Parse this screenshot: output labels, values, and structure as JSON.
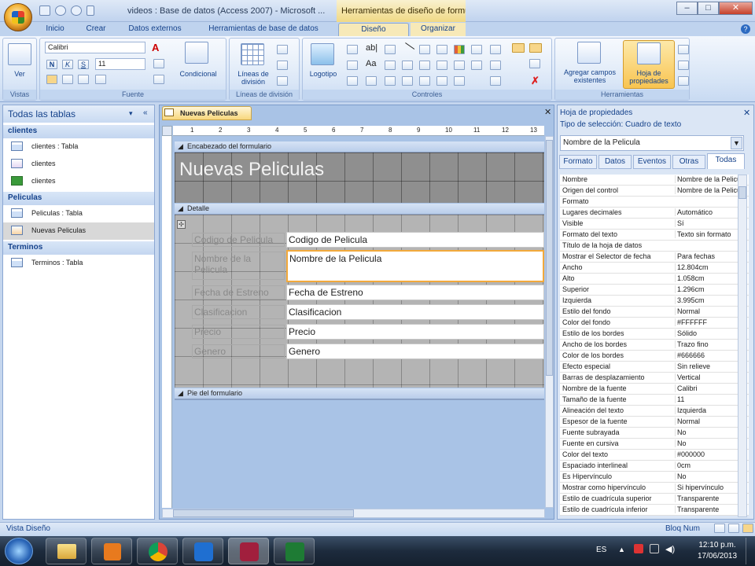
{
  "window": {
    "title": "videos : Base de datos (Access 2007) - Microsoft ...",
    "context_tab_title": "Herramientas de diseño de formulario",
    "controls": [
      "–",
      "□",
      "✕"
    ]
  },
  "ribbon_tabs": [
    {
      "label": "Inicio"
    },
    {
      "label": "Crear"
    },
    {
      "label": "Datos externos"
    },
    {
      "label": "Herramientas de base de datos"
    },
    {
      "label": "Diseño"
    },
    {
      "label": "Organizar"
    }
  ],
  "ribbon": {
    "vistas": {
      "label": "Vistas",
      "ver": "Ver"
    },
    "fuente": {
      "label": "Fuente",
      "font_name": "Calibri",
      "font_size": "11",
      "condicional": "Condicional",
      "bold": "N",
      "italic": "K",
      "underline": "S"
    },
    "lineas": {
      "label": "Líneas de división",
      "button": "Líneas de división"
    },
    "controles": {
      "label": "Controles",
      "logotipo": "Logotipo"
    },
    "herramientas": {
      "label": "Herramientas",
      "agregar": "Agregar campos existentes",
      "hoja": "Hoja de propiedades"
    }
  },
  "nav": {
    "header": "Todas las tablas",
    "groups": [
      {
        "name": "clientes",
        "items": [
          {
            "label": "clientes : Tabla",
            "icon": "table-icon"
          },
          {
            "label": "clientes",
            "icon": "query-icon"
          },
          {
            "label": "clientes",
            "icon": "form-icon"
          }
        ]
      },
      {
        "name": "Peliculas",
        "items": [
          {
            "label": "Peliculas : Tabla",
            "icon": "table-icon"
          },
          {
            "label": "Nuevas Peliculas",
            "icon": "form-icon",
            "selected": true
          }
        ]
      },
      {
        "name": "Terminos",
        "items": [
          {
            "label": "Terminos : Tabla",
            "icon": "table-icon"
          }
        ]
      }
    ]
  },
  "document": {
    "tab": "Nuevas Peliculas",
    "ruler_numbers": [
      "1",
      "2",
      "3",
      "4",
      "5",
      "6",
      "7",
      "8",
      "9",
      "10",
      "11",
      "12",
      "13"
    ],
    "section_header": "Encabezado del formulario",
    "section_detail": "Detalle",
    "section_footer": "Pie del formulario",
    "form_title": "Nuevas Peliculas",
    "fields": [
      {
        "label": "Codigo de Pelicula",
        "control": "Codigo de Pelicula"
      },
      {
        "label": "Nombre de la Pelicula",
        "control": "Nombre de la Pelicula"
      },
      {
        "label": "Fecha de Estreno",
        "control": "Fecha de Estreno"
      },
      {
        "label": "Clasificacion",
        "control": "Clasificacion"
      },
      {
        "label": "Precio",
        "control": "Precio"
      },
      {
        "label": "Genero",
        "control": "Genero"
      }
    ],
    "visible_labels": [
      "Codigo de Pelicula",
      "Nombre de la Pelicula",
      "Fecha de Estreno",
      "Clasificacion",
      "Precio",
      "Genero"
    ]
  },
  "property_sheet": {
    "title": "Hoja de propiedades",
    "selection_type": "Tipo de selección:  Cuadro de texto",
    "selected_control": "Nombre de la Pelicula",
    "tabs": [
      "Formato",
      "Datos",
      "Eventos",
      "Otras",
      "Todas"
    ],
    "active_tab": "Todas",
    "rows": [
      {
        "name": "Nombre",
        "value": "Nombre de la Pelicula"
      },
      {
        "name": "Origen del control",
        "value": "Nombre de la Pelicula"
      },
      {
        "name": "Formato",
        "value": ""
      },
      {
        "name": "Lugares decimales",
        "value": "Automático"
      },
      {
        "name": "Visible",
        "value": "Sí"
      },
      {
        "name": "Formato del texto",
        "value": "Texto sin formato"
      },
      {
        "name": "Título de la hoja de datos",
        "value": ""
      },
      {
        "name": "Mostrar el Selector de fecha",
        "value": "Para fechas"
      },
      {
        "name": "Ancho",
        "value": "12.804cm"
      },
      {
        "name": "Alto",
        "value": "1.058cm"
      },
      {
        "name": "Superior",
        "value": "1.296cm"
      },
      {
        "name": "Izquierda",
        "value": "3.995cm"
      },
      {
        "name": "Estilo del fondo",
        "value": "Normal"
      },
      {
        "name": "Color del fondo",
        "value": "#FFFFFF"
      },
      {
        "name": "Estilo de los bordes",
        "value": "Sólido"
      },
      {
        "name": "Ancho de los bordes",
        "value": "Trazo fino"
      },
      {
        "name": "Color de los bordes",
        "value": "#666666"
      },
      {
        "name": "Efecto especial",
        "value": "Sin relieve"
      },
      {
        "name": "Barras de desplazamiento",
        "value": "Vertical"
      },
      {
        "name": "Nombre de la fuente",
        "value": "Calibri"
      },
      {
        "name": "Tamaño de la fuente",
        "value": "11"
      },
      {
        "name": "Alineación del texto",
        "value": "Izquierda"
      },
      {
        "name": "Espesor de la fuente",
        "value": "Normal"
      },
      {
        "name": "Fuente subrayada",
        "value": "No"
      },
      {
        "name": "Fuente en cursiva",
        "value": "No"
      },
      {
        "name": "Color del texto",
        "value": "#000000"
      },
      {
        "name": "Espaciado interlineal",
        "value": "0cm"
      },
      {
        "name": "Es Hipervínculo",
        "value": "No"
      },
      {
        "name": "Mostrar como hipervínculo",
        "value": "Si hipervínculo"
      },
      {
        "name": "Estilo de cuadrícula superior",
        "value": "Transparente"
      },
      {
        "name": "Estilo de cuadrícula inferior",
        "value": "Transparente"
      }
    ]
  },
  "status": {
    "left": "Vista Diseño",
    "right": "Bloq Num"
  },
  "taskbar": {
    "lang": "ES",
    "time": "12:10 p.m.",
    "date": "17/06/2013",
    "apps": [
      "folder-icon",
      "media-player-icon",
      "chrome-icon",
      "teamviewer-icon",
      "access-icon",
      "excel-icon"
    ]
  },
  "colors": {
    "accent": "#15428b",
    "selected_border": "#f2a93b",
    "form_header_bg": "#8f8f8f"
  }
}
